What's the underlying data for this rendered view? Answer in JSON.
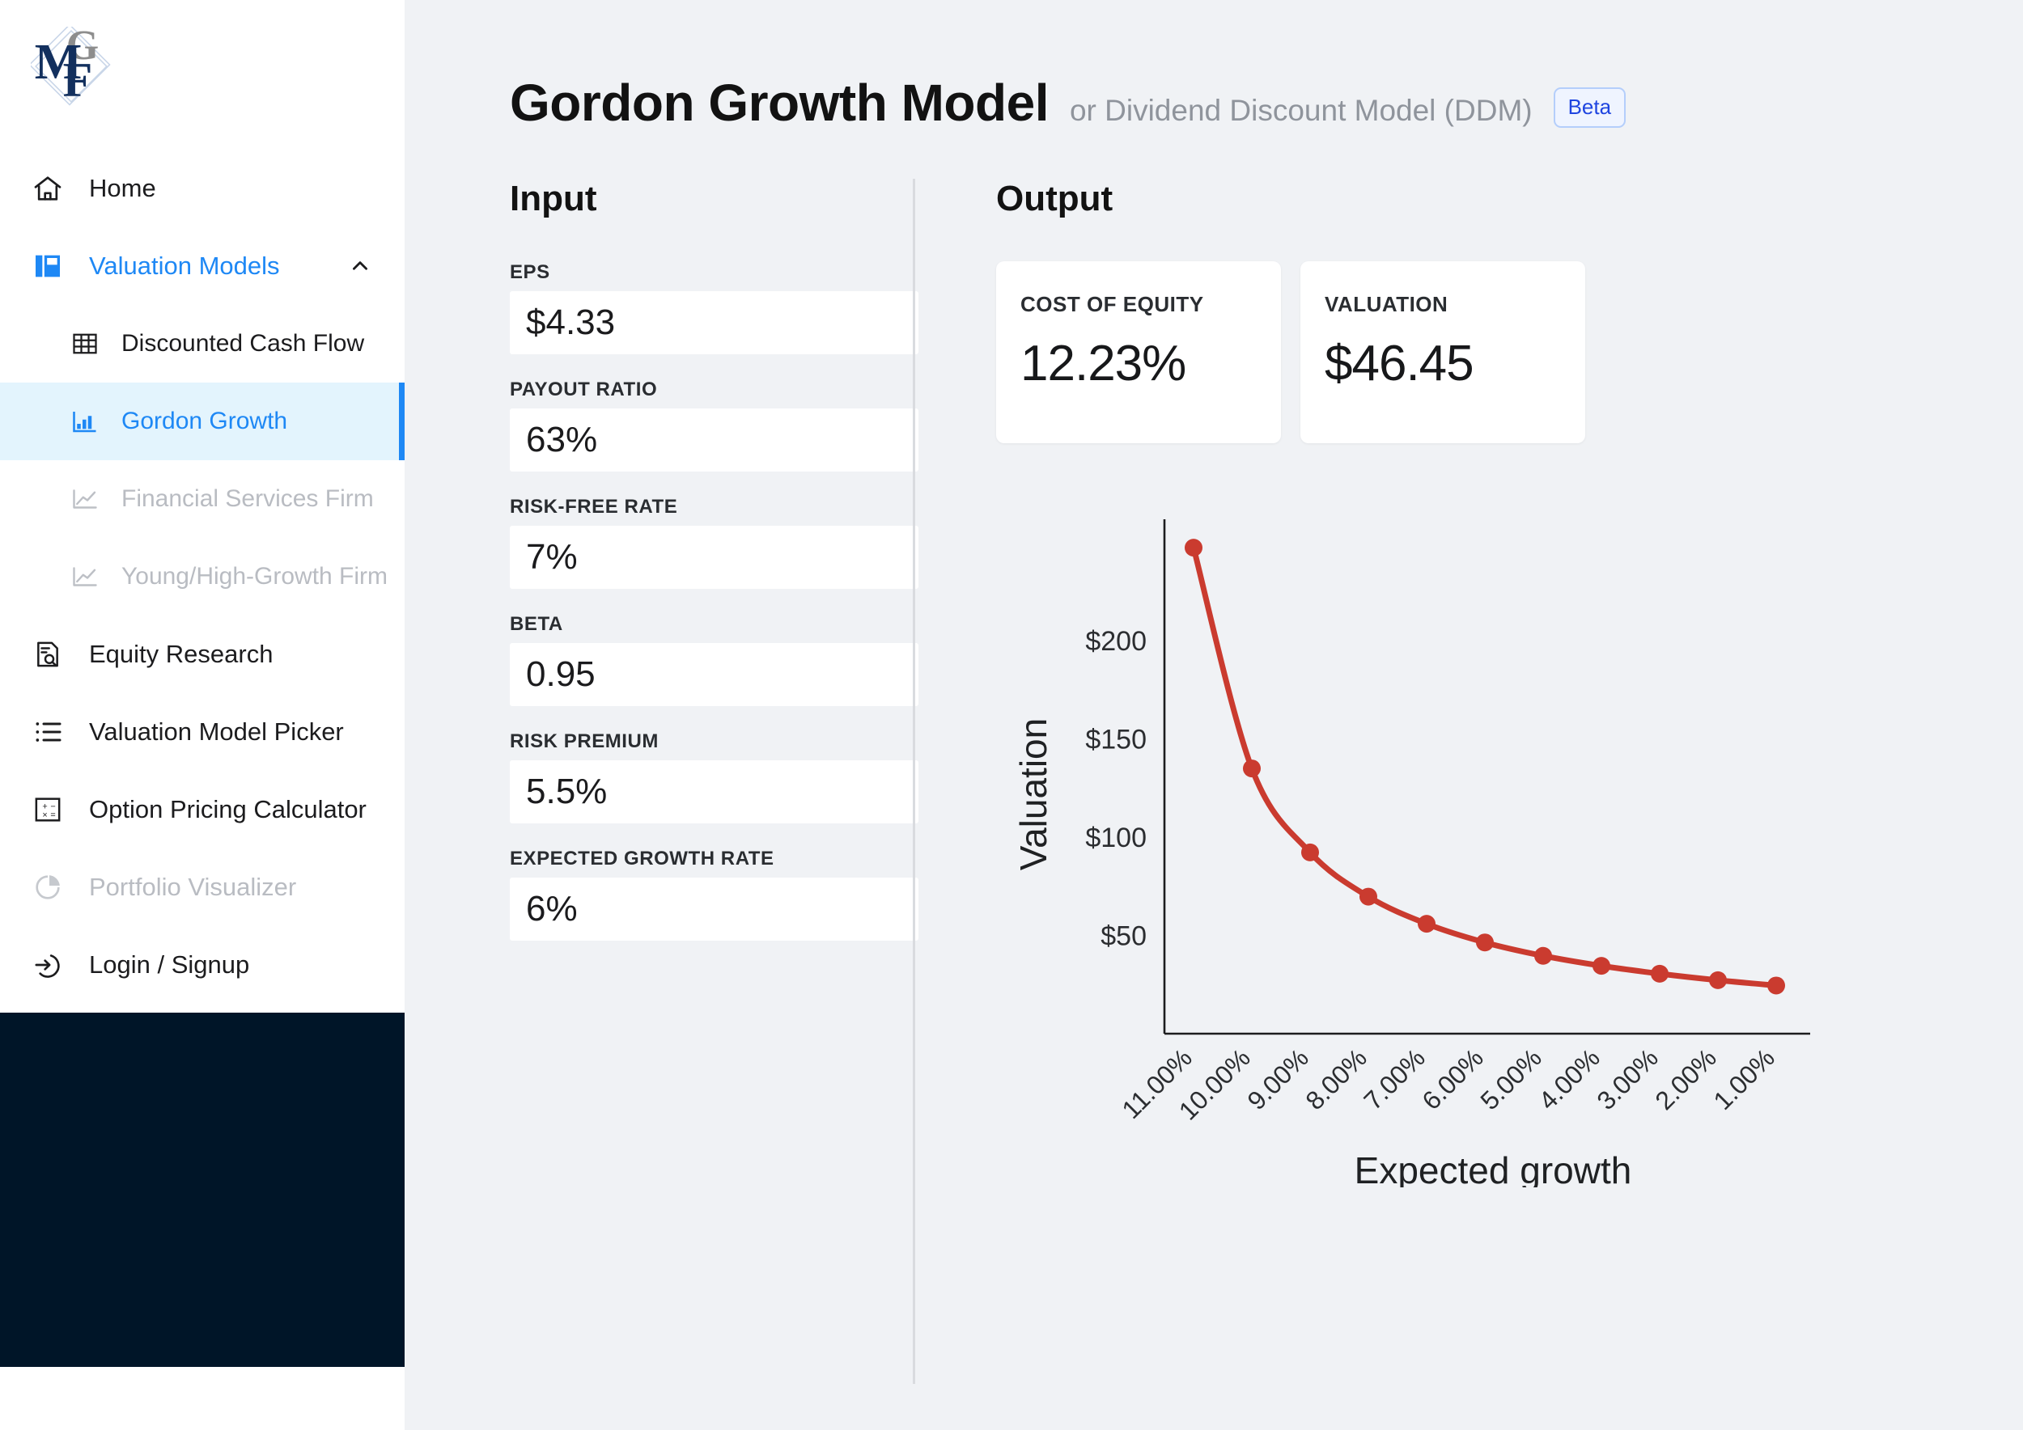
{
  "brand": {
    "logo_letters": [
      "M",
      "G",
      "F"
    ]
  },
  "sidebar": {
    "items": [
      {
        "label": "Home",
        "icon": "home-icon",
        "state": "normal",
        "level": "top"
      },
      {
        "label": "Valuation Models",
        "icon": "book-icon",
        "state": "accent",
        "level": "top",
        "chevron": "chevron-up-icon"
      },
      {
        "label": "Discounted Cash Flow",
        "icon": "table-icon",
        "state": "normal",
        "level": "sub"
      },
      {
        "label": "Gordon Growth",
        "icon": "bar-chart-icon",
        "state": "active",
        "level": "sub"
      },
      {
        "label": "Financial Services Firm",
        "icon": "line-chart-icon",
        "state": "muted",
        "level": "sub"
      },
      {
        "label": "Young/High-Growth Firm",
        "icon": "line-chart-icon",
        "state": "muted",
        "level": "sub"
      },
      {
        "label": "Equity Research",
        "icon": "document-search-icon",
        "state": "normal",
        "level": "top"
      },
      {
        "label": "Valuation Model Picker",
        "icon": "list-icon",
        "state": "normal",
        "level": "top"
      },
      {
        "label": "Option Pricing Calculator",
        "icon": "calculator-icon",
        "state": "normal",
        "level": "top"
      },
      {
        "label": "Portfolio Visualizer",
        "icon": "pie-chart-icon",
        "state": "muted",
        "level": "top"
      },
      {
        "label": "Login / Signup",
        "icon": "login-icon",
        "state": "normal",
        "level": "top"
      }
    ]
  },
  "header": {
    "title": "Gordon Growth Model",
    "subtitle": "or Dividend Discount Model (DDM)",
    "badge": "Beta"
  },
  "input": {
    "section_title": "Input",
    "fields": [
      {
        "label": "EPS",
        "value": "$4.33"
      },
      {
        "label": "PAYOUT RATIO",
        "value": "63%"
      },
      {
        "label": "RISK-FREE RATE",
        "value": "7%"
      },
      {
        "label": "BETA",
        "value": "0.95"
      },
      {
        "label": "RISK PREMIUM",
        "value": "5.5%"
      },
      {
        "label": "EXPECTED GROWTH RATE",
        "value": "6%"
      }
    ]
  },
  "output": {
    "section_title": "Output",
    "cards": [
      {
        "label": "COST OF EQUITY",
        "value": "12.23%"
      },
      {
        "label": "VALUATION",
        "value": "$46.45"
      }
    ]
  },
  "colors": {
    "accent": "#1e88f5",
    "active_bg": "#e3f4fd",
    "series": "#ca3b2f",
    "navy": "#001528",
    "page_bg": "#f0f2f5",
    "badge_text": "#1f45e0",
    "badge_border": "#b4cefb"
  },
  "chart_data": {
    "type": "line",
    "title": "",
    "xlabel": "Expected growth",
    "ylabel": "Valuation",
    "categories": [
      "11.00%",
      "10.00%",
      "9.00%",
      "8.00%",
      "7.00%",
      "6.00%",
      "5.00%",
      "4.00%",
      "3.00%",
      "2.00%",
      "1.00%"
    ],
    "values": [
      247.2,
      134.9,
      92.2,
      69.7,
      55.9,
      46.4,
      39.6,
      34.5,
      30.5,
      27.2,
      24.5
    ],
    "ytick_labels": [
      "$200",
      "$150",
      "$100",
      "$50"
    ],
    "ytick_values": [
      200,
      150,
      100,
      50
    ],
    "ylim": [
      0,
      260
    ],
    "grid": false,
    "legend": "none",
    "marker": "circle",
    "series_color": "#ca3b2f"
  }
}
